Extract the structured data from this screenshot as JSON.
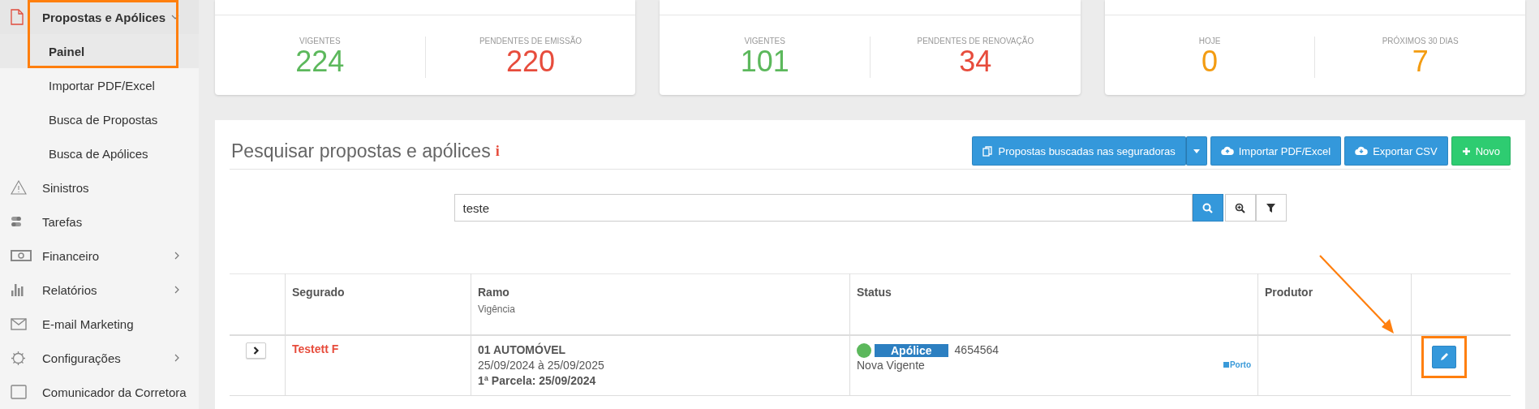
{
  "sidebar": {
    "items": [
      {
        "label": "Propostas e Apólices",
        "kind": "document",
        "expanded": true,
        "highlighted": true,
        "children": [
          {
            "label": "Painel",
            "selected": true
          }
        ]
      },
      {
        "label": "Importar PDF/Excel",
        "kind": "sub"
      },
      {
        "label": "Busca de Propostas",
        "kind": "sub"
      },
      {
        "label": "Busca de Apólices",
        "kind": "sub"
      },
      {
        "label": "Sinistros",
        "kind": "warning",
        "has_submenu": false
      },
      {
        "label": "Tarefas",
        "kind": "toggles",
        "has_submenu": false
      },
      {
        "label": "Financeiro",
        "kind": "money",
        "has_submenu": true
      },
      {
        "label": "Relatórios",
        "kind": "bars",
        "has_submenu": true
      },
      {
        "label": "E-mail Marketing",
        "kind": "mail",
        "has_submenu": false
      },
      {
        "label": "Configurações",
        "kind": "gear",
        "has_submenu": true
      },
      {
        "label": "Comunicador da Corretora",
        "kind": "chat",
        "has_submenu": false
      }
    ]
  },
  "cards": [
    {
      "stats": [
        {
          "label": "VIGENTES",
          "value": "224",
          "color": "#5cb85c"
        },
        {
          "label": "PENDENTES DE EMISSÃO",
          "value": "220",
          "color": "#e74c3c"
        }
      ]
    },
    {
      "stats": [
        {
          "label": "VIGENTES",
          "value": "101",
          "color": "#5cb85c"
        },
        {
          "label": "PENDENTES DE RENOVAÇÃO",
          "value": "34",
          "color": "#e74c3c"
        }
      ]
    },
    {
      "stats": [
        {
          "label": "HOJE",
          "value": "0",
          "color": "#f39c12"
        },
        {
          "label": "PRÓXIMOS 30 DIAS",
          "value": "7",
          "color": "#f39c12"
        }
      ]
    }
  ],
  "search_panel": {
    "title": "Pesquisar propostas e apólices",
    "info_mark": "i",
    "buttons": [
      {
        "label": "Propostas buscadas nas seguradoras",
        "kind": "split",
        "color": "#3498db"
      },
      {
        "label": "Importar PDF/Excel",
        "kind": "upload",
        "color": "#3498db"
      },
      {
        "label": "Exportar CSV",
        "kind": "download",
        "color": "#3498db"
      },
      {
        "label": "Novo",
        "kind": "plus",
        "color": "#2ecc71"
      }
    ],
    "search": {
      "value": "teste"
    }
  },
  "table": {
    "columns": [
      {
        "label": "Segurado"
      },
      {
        "label": "Ramo",
        "sub": "Vigência"
      },
      {
        "label": "Status"
      },
      {
        "label": "Produtor"
      }
    ],
    "rows": [
      {
        "segurado": "Testett F",
        "ramo": "01 AUTOMÓVEL",
        "vigencia": "25/09/2024 à 25/09/2025",
        "parcela": "1ª Parcela: 25/09/2024",
        "status": {
          "color": "#5cb85c",
          "tag": "Apólice",
          "number": "4654564",
          "text": "Nova Vigente"
        },
        "insurer": "Porto",
        "edit_highlighted": true
      }
    ]
  }
}
